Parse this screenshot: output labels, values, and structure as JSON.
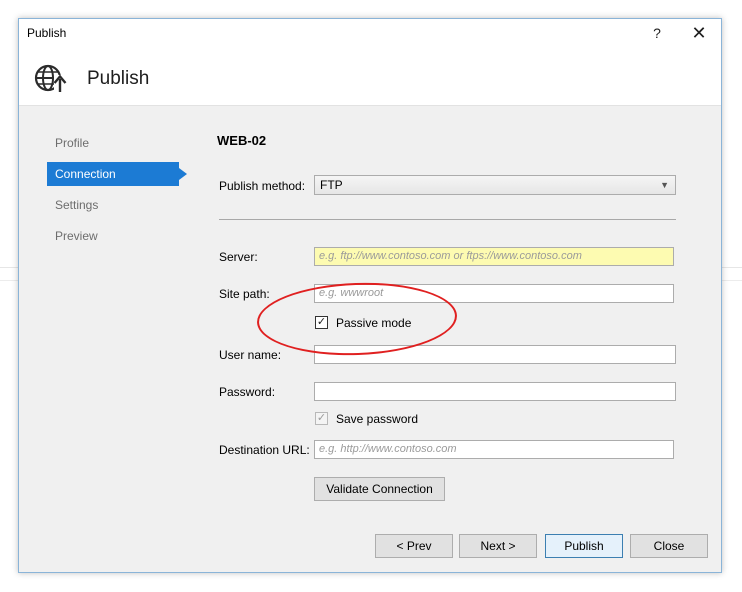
{
  "window": {
    "title": "Publish",
    "help_label": "?",
    "close_label": "✕"
  },
  "header": {
    "title": "Publish",
    "icon": "globe-publish-icon"
  },
  "nav": {
    "items": [
      {
        "label": "Profile"
      },
      {
        "label": "Connection",
        "active": true
      },
      {
        "label": "Settings"
      },
      {
        "label": "Preview"
      }
    ]
  },
  "form": {
    "profile_name": "WEB-02",
    "publish_method": {
      "label": "Publish method:",
      "value": "FTP"
    },
    "server": {
      "label": "Server:",
      "placeholder": "e.g. ftp://www.contoso.com or ftps://www.contoso.com"
    },
    "site_path": {
      "label": "Site path:",
      "placeholder": "e.g. wwwroot"
    },
    "passive_mode": {
      "label": "Passive mode",
      "checked": true
    },
    "user_name": {
      "label": "User name:",
      "value": ""
    },
    "password": {
      "label": "Password:",
      "value": ""
    },
    "save_password": {
      "label": "Save password",
      "checked": true
    },
    "destination_url": {
      "label": "Destination URL:",
      "placeholder": "e.g. http://www.contoso.com"
    },
    "validate_label": "Validate Connection"
  },
  "footer": {
    "prev_label": "< Prev",
    "next_label": "Next >",
    "publish_label": "Publish",
    "close_label": "Close"
  },
  "colors": {
    "accent": "#1c7bd4",
    "annotation": "#e02020",
    "server_highlight": "#fdfbb1"
  }
}
